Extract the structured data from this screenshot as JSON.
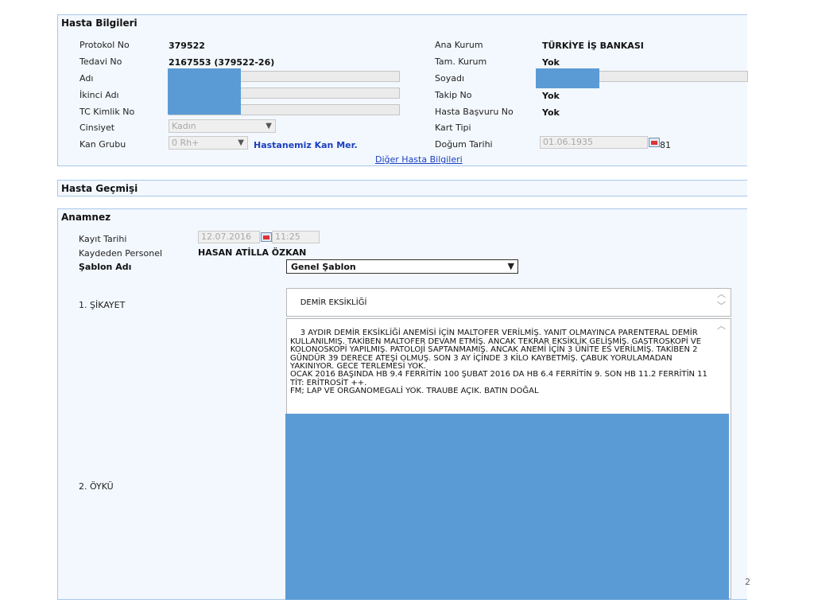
{
  "hasta_bilgileri": {
    "title": "Hasta Bilgileri",
    "protokol_label": "Protokol No",
    "protokol_value": "379522",
    "tedavi_label": "Tedavi No",
    "tedavi_value": "2167553 (379522-26)",
    "adi_label": "Adı",
    "ikinci_adi_label": "İkinci Adı",
    "tc_label": "TC Kimlik No",
    "cinsiyet_label": "Cinsiyet",
    "cinsiyet_value": "Kadın",
    "kan_grubu_label": "Kan Grubu",
    "kan_grubu_value": "0 Rh+",
    "kan_merkezi_link": "Hastanemiz Kan Mer.",
    "ana_kurum_label": "Ana Kurum",
    "ana_kurum_value": "TÜRKİYE İŞ BANKASI",
    "tam_kurum_label": "Tam. Kurum",
    "tam_kurum_value": "Yok",
    "soyadi_label": "Soyadı",
    "takip_label": "Takip No",
    "takip_value": "Yok",
    "basvuru_label": "Hasta Başvuru No",
    "basvuru_value": "Yok",
    "kart_tipi_label": "Kart Tipi",
    "dogum_label": "Doğum Tarihi",
    "dogum_value": "01.06.1935",
    "yas_value": "81",
    "diger_link": "Diğer Hasta Bilgileri"
  },
  "hasta_gecmisi": {
    "title": "Hasta Geçmişi"
  },
  "anamnez": {
    "title": "Anamnez",
    "kayit_tarihi_label": "Kayıt Tarihi",
    "kayit_tarihi_value": "12.07.2016",
    "kayit_saati_value": "11:25",
    "kaydeden_label": "Kaydeden Personel",
    "kaydeden_value": "HASAN ATİLLA ÖZKAN",
    "sablon_label": "Şablon Adı",
    "sablon_value": "Genel Şablon",
    "sikayet_label": "1. ŞİKAYET",
    "sikayet_text": "DEMİR EKSİKLİĞİ",
    "oyku_label": "2. ÖYKÜ",
    "oyku_text": "3 AYDIR DEMİR EKSİKLİĞİ ANEMİSİ İÇİN MALTOFER VERİLMİŞ. YANIT OLMAYINCA PARENTERAL DEMİR KULLANILMIŞ. TAKİBEN MALTOFER DEVAM ETMİŞ. ANCAK TEKRAR EKSİKLİK GELİŞMİŞ. GASTROSKOPİ VE KOLONOSKOPİ YAPILMIŞ. PATOLOJİ SAPTANMAMIŞ. ANCAK ANEMİ İÇİN 3 ÜNİTE ES VERİLMİŞ. TAKİBEN 2 GÜNDÜR 39 DERECE ATEŞİ OLMUŞ. SON 3 AY İÇİNDE 3 KİLO KAYBETMİŞ. ÇABUK YORULAMADAN YAKINIYOR. GECE TERLEMESİ YOK.\nOCAK 2016 BAŞINDA HB 9.4 FERRİTİN 100 ŞUBAT 2016 DA HB 6.4 FERRİTİN 9. SON HB 11.2 FERRİTİN 11\nTİT: ERİTROSİT ++.\nFM; LAP VE ORGANOMEGALİ YOK. TRAUBE AÇIK. BATIN DOĞAL",
    "page_fragment": "2"
  },
  "colors": {
    "panel_bg": "#f3f8fe",
    "panel_border": "#a9c7ea",
    "redaction": "#5b9bd5",
    "link": "#1a3fbf"
  }
}
